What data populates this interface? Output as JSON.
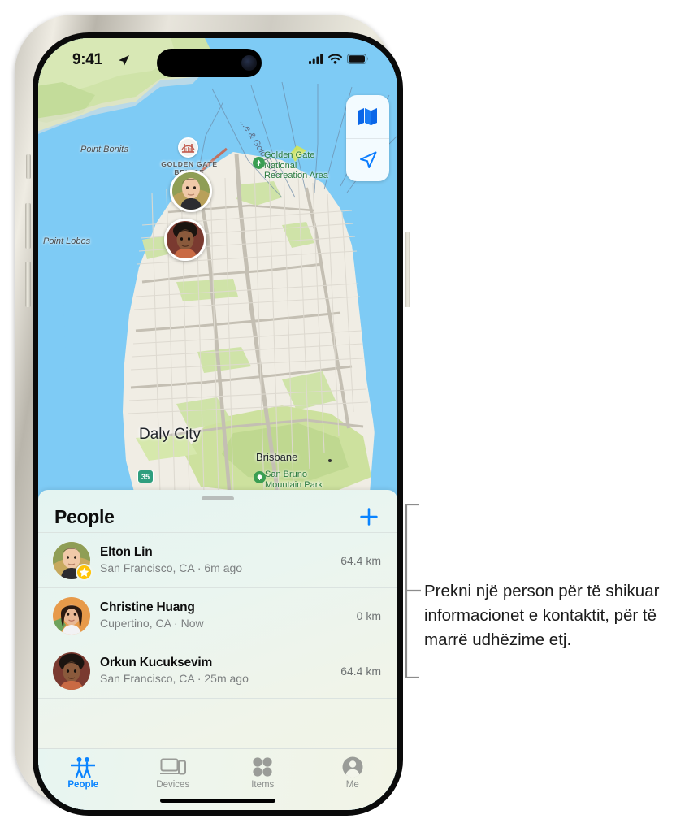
{
  "status_bar": {
    "time": "9:41",
    "location_icon": "location-arrow-icon",
    "cellular_icon": "cellular-bars-icon",
    "wifi_icon": "wifi-icon",
    "battery_icon": "battery-icon"
  },
  "map": {
    "controls": [
      {
        "name": "map-layers-button",
        "icon": "folded-map-icon"
      },
      {
        "name": "recenter-button",
        "icon": "location-arrow-icon"
      }
    ],
    "labels": {
      "point_bonita": "Point Bonita",
      "point_lobos": "Point Lobos",
      "golden_gate_bridge": "GOLDEN GATE\nBRIDGE",
      "ferry_route": "...e & Gold Ferry",
      "ggnra": "Golden Gate\nNational\nRecreation Area",
      "daly_city": "Daly City",
      "brisbane": "Brisbane",
      "san_bruno": "San Bruno\nMountain Park",
      "route_shield": "35"
    },
    "pins": [
      {
        "name": "map-pin-elton-lin",
        "person": "Elton Lin"
      },
      {
        "name": "map-pin-orkun-kucuksevim",
        "person": "Orkun Kucuksevim"
      }
    ]
  },
  "sheet": {
    "title": "People",
    "add_button_label": "+",
    "people": [
      {
        "name": "Elton Lin",
        "subtitle": "San Francisco, CA · 6m ago",
        "distance": "64.4 km",
        "favorite": true
      },
      {
        "name": "Christine Huang",
        "subtitle": "Cupertino, CA · Now",
        "distance": "0 km",
        "favorite": false
      },
      {
        "name": "Orkun Kucuksevim",
        "subtitle": "San Francisco, CA · 25m ago",
        "distance": "64.4 km",
        "favorite": false
      }
    ]
  },
  "tabbar": {
    "tabs": [
      {
        "label": "People",
        "icon": "people-icon",
        "active": true
      },
      {
        "label": "Devices",
        "icon": "devices-icon",
        "active": false
      },
      {
        "label": "Items",
        "icon": "items-icon",
        "active": false
      },
      {
        "label": "Me",
        "icon": "person-circle-icon",
        "active": false
      }
    ]
  },
  "callout": {
    "text": "Prekni një person për të shikuar informacionet e kontaktit, për të marrë udhëzime etj."
  },
  "colors": {
    "accent": "#0a84ff",
    "favorite_star": "#ffc408",
    "water": "#7ecbf5",
    "park": "#3a9e52"
  }
}
